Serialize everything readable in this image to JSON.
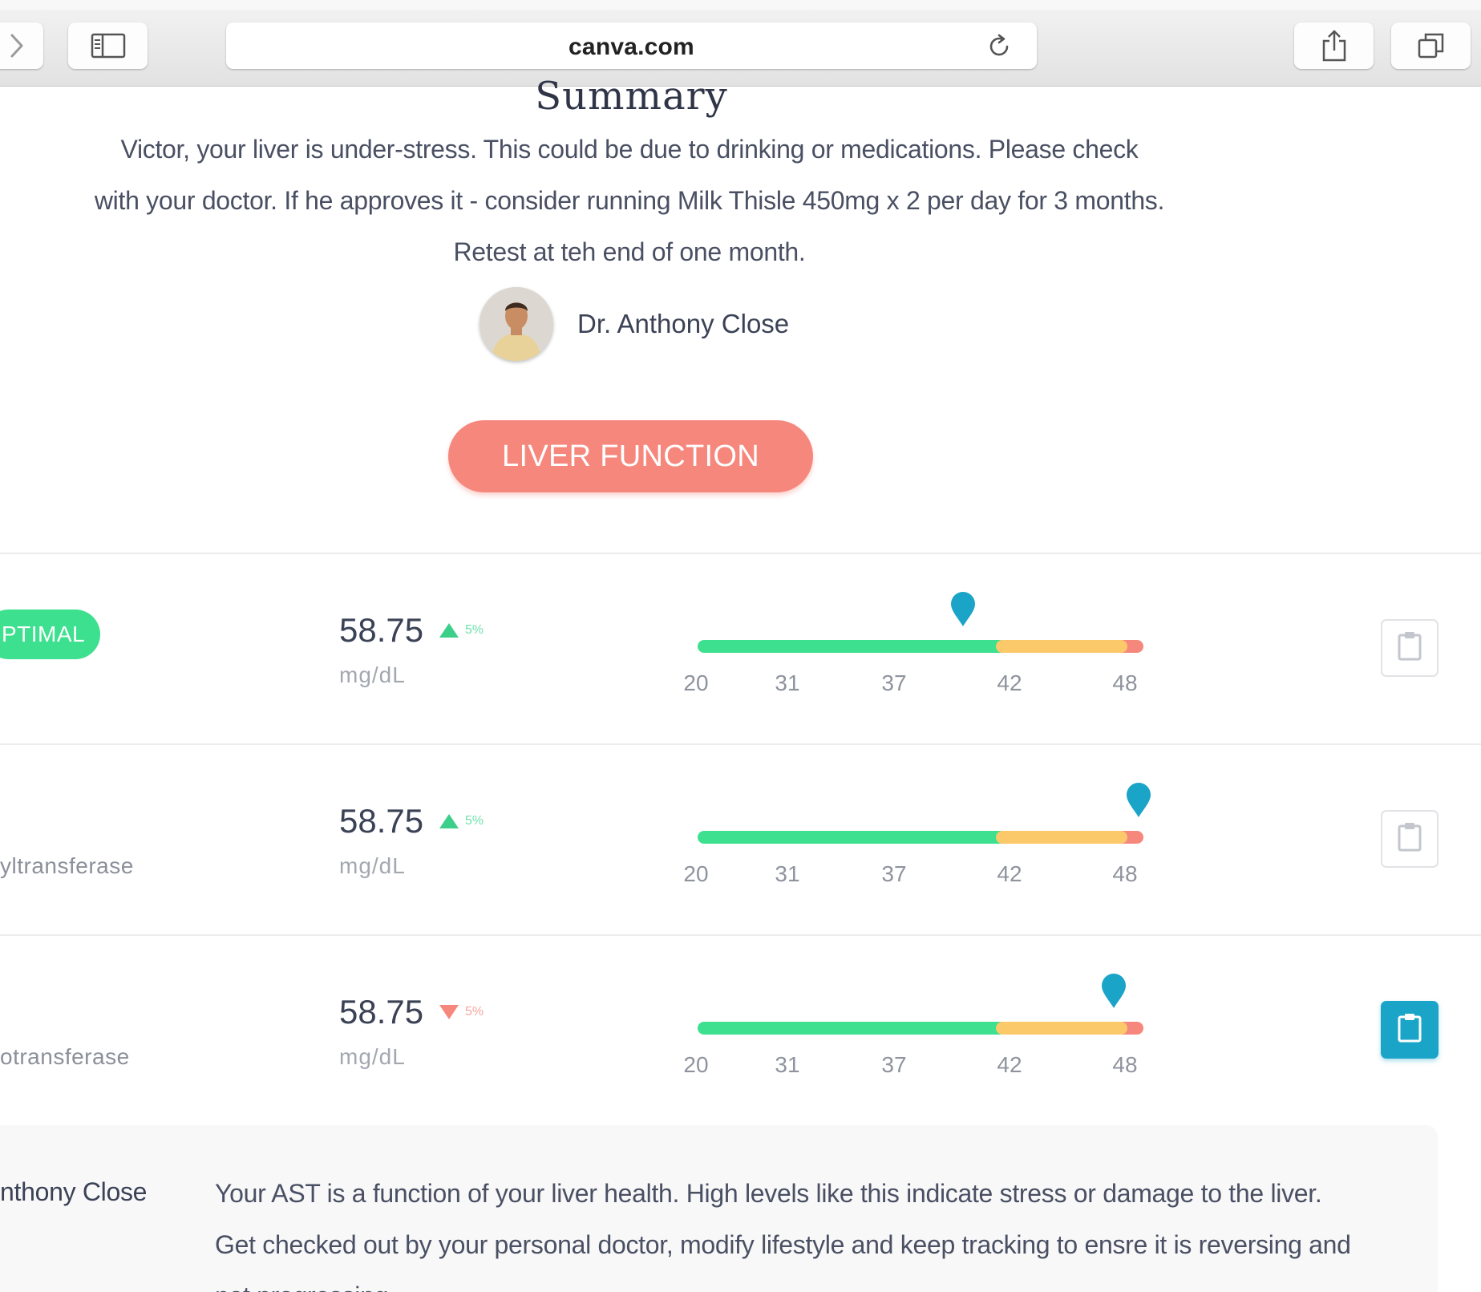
{
  "browser": {
    "url": "canva.com",
    "icons": {
      "forward": "chevron-right-icon",
      "sidebar": "sidebar-icon",
      "reload": "reload-icon",
      "share": "share-icon",
      "tabs": "tabs-icon"
    }
  },
  "summary": {
    "title": "Summary",
    "lines": [
      "Victor, your liver is under-stress.  This could be due to drinking or medications.  Please check",
      "with your doctor.  If he approves it - consider running Milk Thisle 450mg x 2 per day for 3 months.",
      "Retest at teh end of one month."
    ],
    "doctor_name": "Dr. Anthony Close"
  },
  "section": {
    "label": "LIVER FUNCTION",
    "color": "#f6877c"
  },
  "colors": {
    "optimal": "#3ce08e",
    "borderline": "#fbc96a",
    "high": "#f6877c",
    "marker": "#1aa4c8"
  },
  "rows": [
    {
      "status": "PTIMAL",
      "name": "",
      "value": "58.75",
      "trend": "up",
      "delta": "5%",
      "unit": "mg/dL",
      "ticks": [
        "20",
        "31",
        "37",
        "42",
        "48"
      ],
      "marker_value": 40,
      "action_icon": "clipboard-icon",
      "action_active": false
    },
    {
      "status": "",
      "name": "yltransferase",
      "value": "58.75",
      "trend": "up",
      "delta": "5%",
      "unit": "mg/dL",
      "ticks": [
        "20",
        "31",
        "37",
        "42",
        "48"
      ],
      "marker_value": 48.7,
      "action_icon": "clipboard-icon",
      "action_active": false
    },
    {
      "status": "",
      "name": "otransferase",
      "value": "58.75",
      "trend": "down",
      "delta": "5%",
      "unit": "mg/dL",
      "ticks": [
        "20",
        "31",
        "37",
        "42",
        "48"
      ],
      "marker_value": 47.4,
      "action_icon": "clipboard-icon",
      "action_active": true
    }
  ],
  "comment": {
    "author": "nthony Close",
    "lines": [
      "Your AST is a function of your liver health.  High levels like this indicate stress or damage to the liver.",
      "Get checked out by your personal doctor, modify lifestyle and keep tracking to ensre it is reversing and",
      "not progressing."
    ]
  }
}
